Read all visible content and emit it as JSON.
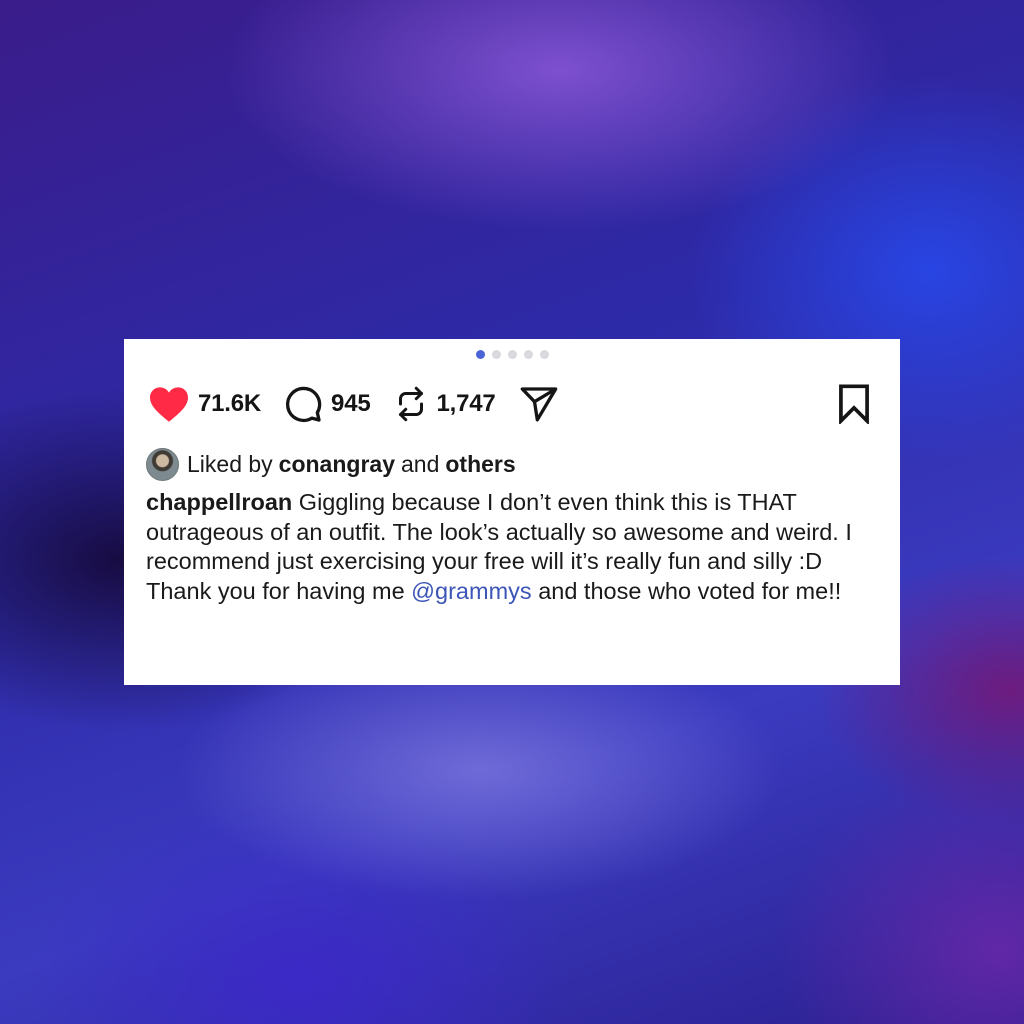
{
  "carousel": {
    "total": 5,
    "active_index": 0
  },
  "actions": {
    "like": {
      "icon": "heart-filled-icon",
      "count": "71.6K",
      "color": "#ff2a45"
    },
    "comment": {
      "icon": "comment-icon",
      "count": "945"
    },
    "repost": {
      "icon": "repost-icon",
      "count": "1,747"
    },
    "share": {
      "icon": "send-icon"
    },
    "save": {
      "icon": "bookmark-icon"
    }
  },
  "likes": {
    "prefix": "Liked by",
    "user": "conangray",
    "joiner": "and",
    "others": "others"
  },
  "caption": {
    "username": "chappellroan",
    "text": "Giggling because I don’t even think this is THAT outrageous of an outfit. The look’s actually so awesome and weird. I recommend just exercising your free will it’s really fun and silly :D",
    "line2_before": "Thank you for having me",
    "mention": "@grammys",
    "line2_after": "and those who voted for me!!"
  },
  "colors": {
    "mention": "#3d55b7",
    "active_dot": "#4a63d6",
    "inactive_dot": "#d7d9de"
  }
}
